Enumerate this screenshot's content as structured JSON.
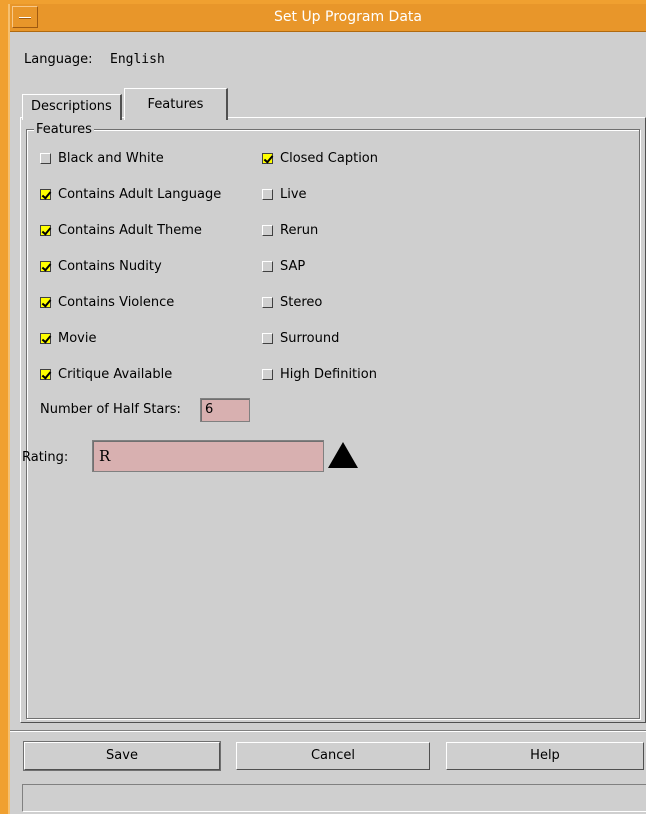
{
  "window": {
    "title": "Set Up Program Data"
  },
  "language": {
    "label": "Language:",
    "value": "English"
  },
  "tabs": [
    {
      "label": "Descriptions",
      "active": false
    },
    {
      "label": "Features",
      "active": true
    }
  ],
  "features": {
    "group_label": "Features",
    "left_column": [
      {
        "label": "Black and White",
        "checked": false
      },
      {
        "label": "Contains Adult Language",
        "checked": true
      },
      {
        "label": "Contains Adult Theme",
        "checked": true
      },
      {
        "label": "Contains Nudity",
        "checked": true
      },
      {
        "label": "Contains Violence",
        "checked": true
      },
      {
        "label": "Movie",
        "checked": true
      },
      {
        "label": "Critique Available",
        "checked": true
      }
    ],
    "right_column": [
      {
        "label": "Closed Caption",
        "checked": true
      },
      {
        "label": "Live",
        "checked": false
      },
      {
        "label": "Rerun",
        "checked": false
      },
      {
        "label": "SAP",
        "checked": false
      },
      {
        "label": "Stereo",
        "checked": false
      },
      {
        "label": "Surround",
        "checked": false
      },
      {
        "label": "High Definition",
        "checked": false
      }
    ],
    "half_stars": {
      "label": "Number of Half Stars:",
      "value": "6"
    },
    "rating": {
      "label": "Rating:",
      "value": "R"
    }
  },
  "buttons": {
    "save": "Save",
    "cancel": "Cancel",
    "help": "Help"
  },
  "status": {
    "text": ""
  },
  "colors": {
    "titlebar": "#e8962a",
    "window_bg": "#cfcfcf",
    "checkbox_checked": "#ffff00",
    "input_bg": "#d8b0b0"
  }
}
